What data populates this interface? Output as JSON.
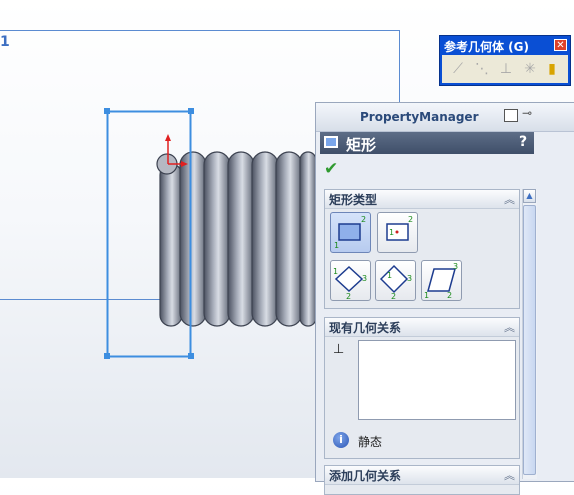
{
  "plane": {
    "label": "1"
  },
  "toolbar": {
    "title": "参考几何体 (G)",
    "close": "✕",
    "icons": [
      "plane-icon",
      "axis-icon",
      "coordinate-system-icon",
      "point-icon",
      "mate-reference-icon"
    ]
  },
  "property_manager": {
    "title": "PropertyManager",
    "feature_name": "矩形",
    "help": "?",
    "ok": "✔",
    "rect_type": {
      "title": "矩形类型",
      "collapse": "︽",
      "options": [
        {
          "name": "corner-rectangle",
          "selected": true,
          "num_a": "1",
          "num_b": "2"
        },
        {
          "name": "center-rectangle",
          "selected": false,
          "num_a": "1",
          "num_b": "2"
        },
        {
          "name": "3point-corner-rectangle",
          "selected": false,
          "num_a": "1",
          "num_b": "2",
          "num_c": "3"
        },
        {
          "name": "3point-center-rectangle",
          "selected": false,
          "num_a": "1",
          "num_b": "2",
          "num_c": "3"
        },
        {
          "name": "parallelogram",
          "selected": false,
          "num_a": "1",
          "num_b": "2",
          "num_c": "3"
        }
      ]
    },
    "existing_relations": {
      "title": "现有几何关系",
      "collapse": "︽",
      "status": "静态"
    },
    "add_relations": {
      "title": "添加几何关系",
      "collapse": "︽"
    }
  },
  "colors": {
    "accent": "#3d8ee0",
    "spring": "#7d8492",
    "pm_header": "#4a5a74"
  }
}
